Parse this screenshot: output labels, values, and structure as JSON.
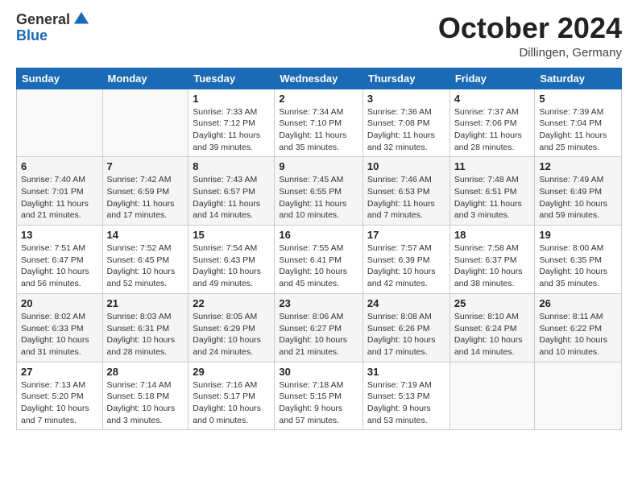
{
  "logo": {
    "general": "General",
    "blue": "Blue"
  },
  "title": "October 2024",
  "location": "Dillingen, Germany",
  "days_of_week": [
    "Sunday",
    "Monday",
    "Tuesday",
    "Wednesday",
    "Thursday",
    "Friday",
    "Saturday"
  ],
  "weeks": [
    [
      {
        "num": "",
        "sunrise": "",
        "sunset": "",
        "daylight": ""
      },
      {
        "num": "",
        "sunrise": "",
        "sunset": "",
        "daylight": ""
      },
      {
        "num": "1",
        "sunrise": "Sunrise: 7:33 AM",
        "sunset": "Sunset: 7:12 PM",
        "daylight": "Daylight: 11 hours and 39 minutes."
      },
      {
        "num": "2",
        "sunrise": "Sunrise: 7:34 AM",
        "sunset": "Sunset: 7:10 PM",
        "daylight": "Daylight: 11 hours and 35 minutes."
      },
      {
        "num": "3",
        "sunrise": "Sunrise: 7:36 AM",
        "sunset": "Sunset: 7:08 PM",
        "daylight": "Daylight: 11 hours and 32 minutes."
      },
      {
        "num": "4",
        "sunrise": "Sunrise: 7:37 AM",
        "sunset": "Sunset: 7:06 PM",
        "daylight": "Daylight: 11 hours and 28 minutes."
      },
      {
        "num": "5",
        "sunrise": "Sunrise: 7:39 AM",
        "sunset": "Sunset: 7:04 PM",
        "daylight": "Daylight: 11 hours and 25 minutes."
      }
    ],
    [
      {
        "num": "6",
        "sunrise": "Sunrise: 7:40 AM",
        "sunset": "Sunset: 7:01 PM",
        "daylight": "Daylight: 11 hours and 21 minutes."
      },
      {
        "num": "7",
        "sunrise": "Sunrise: 7:42 AM",
        "sunset": "Sunset: 6:59 PM",
        "daylight": "Daylight: 11 hours and 17 minutes."
      },
      {
        "num": "8",
        "sunrise": "Sunrise: 7:43 AM",
        "sunset": "Sunset: 6:57 PM",
        "daylight": "Daylight: 11 hours and 14 minutes."
      },
      {
        "num": "9",
        "sunrise": "Sunrise: 7:45 AM",
        "sunset": "Sunset: 6:55 PM",
        "daylight": "Daylight: 11 hours and 10 minutes."
      },
      {
        "num": "10",
        "sunrise": "Sunrise: 7:46 AM",
        "sunset": "Sunset: 6:53 PM",
        "daylight": "Daylight: 11 hours and 7 minutes."
      },
      {
        "num": "11",
        "sunrise": "Sunrise: 7:48 AM",
        "sunset": "Sunset: 6:51 PM",
        "daylight": "Daylight: 11 hours and 3 minutes."
      },
      {
        "num": "12",
        "sunrise": "Sunrise: 7:49 AM",
        "sunset": "Sunset: 6:49 PM",
        "daylight": "Daylight: 10 hours and 59 minutes."
      }
    ],
    [
      {
        "num": "13",
        "sunrise": "Sunrise: 7:51 AM",
        "sunset": "Sunset: 6:47 PM",
        "daylight": "Daylight: 10 hours and 56 minutes."
      },
      {
        "num": "14",
        "sunrise": "Sunrise: 7:52 AM",
        "sunset": "Sunset: 6:45 PM",
        "daylight": "Daylight: 10 hours and 52 minutes."
      },
      {
        "num": "15",
        "sunrise": "Sunrise: 7:54 AM",
        "sunset": "Sunset: 6:43 PM",
        "daylight": "Daylight: 10 hours and 49 minutes."
      },
      {
        "num": "16",
        "sunrise": "Sunrise: 7:55 AM",
        "sunset": "Sunset: 6:41 PM",
        "daylight": "Daylight: 10 hours and 45 minutes."
      },
      {
        "num": "17",
        "sunrise": "Sunrise: 7:57 AM",
        "sunset": "Sunset: 6:39 PM",
        "daylight": "Daylight: 10 hours and 42 minutes."
      },
      {
        "num": "18",
        "sunrise": "Sunrise: 7:58 AM",
        "sunset": "Sunset: 6:37 PM",
        "daylight": "Daylight: 10 hours and 38 minutes."
      },
      {
        "num": "19",
        "sunrise": "Sunrise: 8:00 AM",
        "sunset": "Sunset: 6:35 PM",
        "daylight": "Daylight: 10 hours and 35 minutes."
      }
    ],
    [
      {
        "num": "20",
        "sunrise": "Sunrise: 8:02 AM",
        "sunset": "Sunset: 6:33 PM",
        "daylight": "Daylight: 10 hours and 31 minutes."
      },
      {
        "num": "21",
        "sunrise": "Sunrise: 8:03 AM",
        "sunset": "Sunset: 6:31 PM",
        "daylight": "Daylight: 10 hours and 28 minutes."
      },
      {
        "num": "22",
        "sunrise": "Sunrise: 8:05 AM",
        "sunset": "Sunset: 6:29 PM",
        "daylight": "Daylight: 10 hours and 24 minutes."
      },
      {
        "num": "23",
        "sunrise": "Sunrise: 8:06 AM",
        "sunset": "Sunset: 6:27 PM",
        "daylight": "Daylight: 10 hours and 21 minutes."
      },
      {
        "num": "24",
        "sunrise": "Sunrise: 8:08 AM",
        "sunset": "Sunset: 6:26 PM",
        "daylight": "Daylight: 10 hours and 17 minutes."
      },
      {
        "num": "25",
        "sunrise": "Sunrise: 8:10 AM",
        "sunset": "Sunset: 6:24 PM",
        "daylight": "Daylight: 10 hours and 14 minutes."
      },
      {
        "num": "26",
        "sunrise": "Sunrise: 8:11 AM",
        "sunset": "Sunset: 6:22 PM",
        "daylight": "Daylight: 10 hours and 10 minutes."
      }
    ],
    [
      {
        "num": "27",
        "sunrise": "Sunrise: 7:13 AM",
        "sunset": "Sunset: 5:20 PM",
        "daylight": "Daylight: 10 hours and 7 minutes."
      },
      {
        "num": "28",
        "sunrise": "Sunrise: 7:14 AM",
        "sunset": "Sunset: 5:18 PM",
        "daylight": "Daylight: 10 hours and 3 minutes."
      },
      {
        "num": "29",
        "sunrise": "Sunrise: 7:16 AM",
        "sunset": "Sunset: 5:17 PM",
        "daylight": "Daylight: 10 hours and 0 minutes."
      },
      {
        "num": "30",
        "sunrise": "Sunrise: 7:18 AM",
        "sunset": "Sunset: 5:15 PM",
        "daylight": "Daylight: 9 hours and 57 minutes."
      },
      {
        "num": "31",
        "sunrise": "Sunrise: 7:19 AM",
        "sunset": "Sunset: 5:13 PM",
        "daylight": "Daylight: 9 hours and 53 minutes."
      },
      {
        "num": "",
        "sunrise": "",
        "sunset": "",
        "daylight": ""
      },
      {
        "num": "",
        "sunrise": "",
        "sunset": "",
        "daylight": ""
      }
    ]
  ]
}
